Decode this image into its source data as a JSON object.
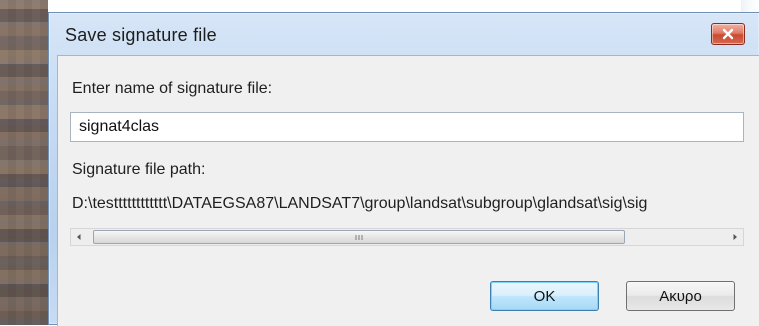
{
  "window": {
    "title": "Save signature file"
  },
  "form": {
    "name_label": "Enter name of signature file:",
    "name_value": "signat4clas",
    "path_label": "Signature file path:",
    "path_value": "D:\\testttttttttttt\\DATAEGSA87\\LANDSAT7\\group\\landsat\\subgroup\\glandsat\\sig\\sig"
  },
  "scrollbar": {
    "position": 0,
    "grip": "III"
  },
  "buttons": {
    "ok_label": "OK",
    "cancel_label": "Ακυρο"
  },
  "icons": {
    "close": "close-icon",
    "scroll_left": "scroll-left-arrow-icon",
    "scroll_right": "scroll-right-arrow-icon",
    "thumb_grip": "scroll-thumb-grip-icon"
  },
  "colors": {
    "close_button": "#c94a2f",
    "default_button_border": "#3c7fb1",
    "window_frame": "#c8dcf3",
    "dialog_background": "#f0f0f0"
  }
}
